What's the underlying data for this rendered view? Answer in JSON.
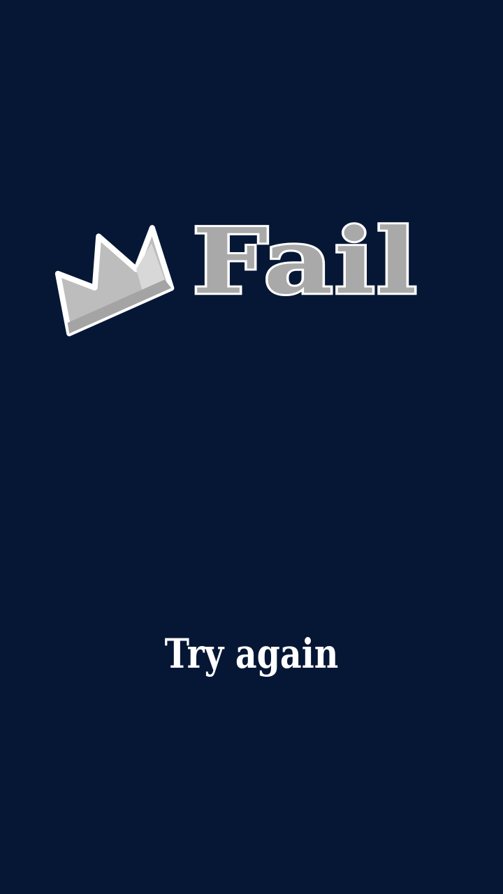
{
  "result": {
    "title": "Fail",
    "icon": "fallen-crown-icon",
    "title_fill_color": "#a9a9a9",
    "title_outline_color": "#ffffff"
  },
  "actions": {
    "retry_label": "Try again"
  },
  "theme": {
    "background": "#061735",
    "text": "#ffffff"
  }
}
